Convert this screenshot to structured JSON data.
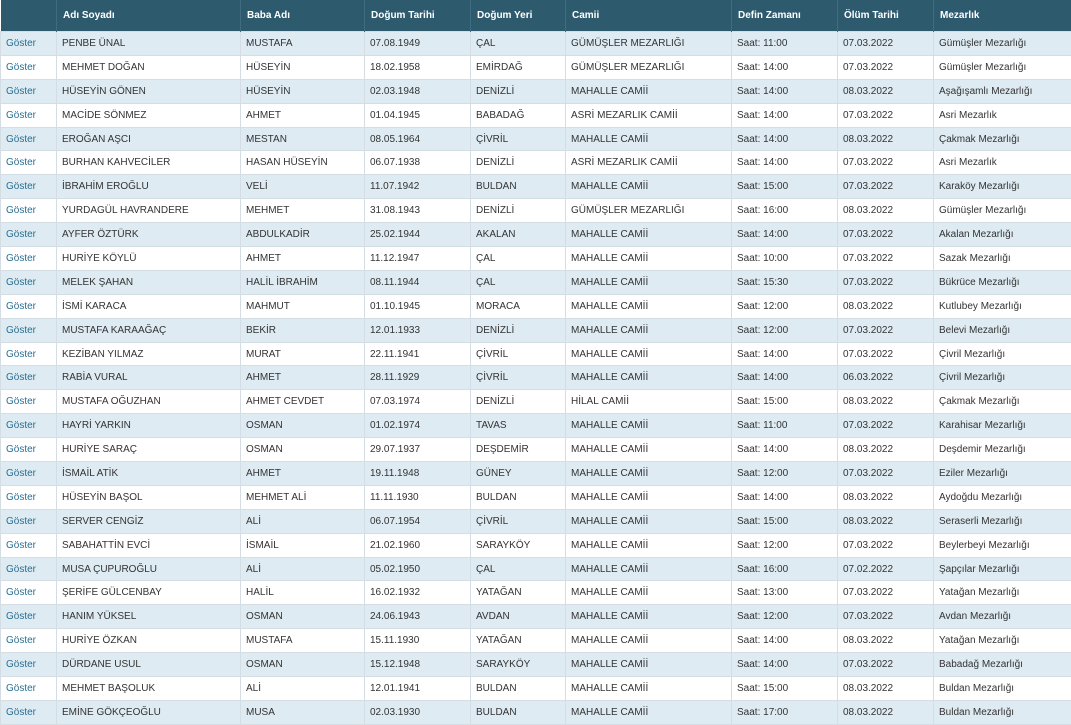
{
  "headers": [
    "",
    "Adı Soyadı",
    "Baba Adı",
    "Doğum Tarihi",
    "Doğum Yeri",
    "Camii",
    "Defin Zamanı",
    "Ölüm Tarihi",
    "Mezarlık"
  ],
  "link_label": "Göster",
  "rows": [
    [
      "PENBE ÜNAL",
      "MUSTAFA",
      "07.08.1949",
      "ÇAL",
      "GÜMÜŞLER MEZARLIĞI",
      "Saat: 11:00",
      "07.03.2022",
      "Gümüşler Mezarlığı"
    ],
    [
      "MEHMET DOĞAN",
      "HÜSEYİN",
      "18.02.1958",
      "EMİRDAĞ",
      "GÜMÜŞLER MEZARLIĞI",
      "Saat: 14:00",
      "07.03.2022",
      "Gümüşler Mezarlığı"
    ],
    [
      "HÜSEYİN GÖNEN",
      "HÜSEYİN",
      "02.03.1948",
      "DENİZLİ",
      "MAHALLE CAMİİ",
      "Saat: 14:00",
      "08.03.2022",
      "Aşağışamlı Mezarlığı"
    ],
    [
      "MACİDE SÖNMEZ",
      "AHMET",
      "01.04.1945",
      "BABADAĞ",
      "ASRİ MEZARLIK CAMİİ",
      "Saat: 14:00",
      "07.03.2022",
      "Asri Mezarlık"
    ],
    [
      "EROĞAN AŞCI",
      "MESTAN",
      "08.05.1964",
      "ÇİVRİL",
      "MAHALLE CAMİİ",
      "Saat: 14:00",
      "08.03.2022",
      "Çakmak Mezarlığı"
    ],
    [
      "BURHAN KAHVECİLER",
      "HASAN HÜSEYİN",
      "06.07.1938",
      "DENİZLİ",
      "ASRİ MEZARLIK CAMİİ",
      "Saat: 14:00",
      "07.03.2022",
      "Asri Mezarlık"
    ],
    [
      "İBRAHİM EROĞLU",
      "VELİ",
      "11.07.1942",
      "BULDAN",
      "MAHALLE CAMİİ",
      "Saat: 15:00",
      "07.03.2022",
      "Karaköy Mezarlığı"
    ],
    [
      "YURDAGÜL HAVRANDERE",
      "MEHMET",
      "31.08.1943",
      "DENİZLİ",
      "GÜMÜŞLER MEZARLIĞI",
      "Saat: 16:00",
      "08.03.2022",
      "Gümüşler Mezarlığı"
    ],
    [
      "AYFER ÖZTÜRK",
      "ABDULKADİR",
      "25.02.1944",
      "AKALAN",
      "MAHALLE CAMİİ",
      "Saat: 14:00",
      "07.03.2022",
      "Akalan Mezarlığı"
    ],
    [
      "HURİYE KÖYLÜ",
      "AHMET",
      "11.12.1947",
      "ÇAL",
      "MAHALLE CAMİİ",
      "Saat: 10:00",
      "07.03.2022",
      "Sazak Mezarlığı"
    ],
    [
      "MELEK ŞAHAN",
      "HALİL İBRAHİM",
      "08.11.1944",
      "ÇAL",
      "MAHALLE CAMİİ",
      "Saat: 15:30",
      "07.03.2022",
      "Bükrüce Mezarlığı"
    ],
    [
      "İSMİ KARACA",
      "MAHMUT",
      "01.10.1945",
      "MORACA",
      "MAHALLE CAMİİ",
      "Saat: 12:00",
      "08.03.2022",
      "Kutlubey Mezarlığı"
    ],
    [
      "MUSTAFA KARAAĞAÇ",
      "BEKİR",
      "12.01.1933",
      "DENİZLİ",
      "MAHALLE CAMİİ",
      "Saat: 12:00",
      "07.03.2022",
      "Belevi Mezarlığı"
    ],
    [
      "KEZİBAN YILMAZ",
      "MURAT",
      "22.11.1941",
      "ÇİVRİL",
      "MAHALLE CAMİİ",
      "Saat: 14:00",
      "07.03.2022",
      "Çivril Mezarlığı"
    ],
    [
      "RABİA VURAL",
      "AHMET",
      "28.11.1929",
      "ÇİVRİL",
      "MAHALLE CAMİİ",
      "Saat: 14:00",
      "06.03.2022",
      "Çivril Mezarlığı"
    ],
    [
      "MUSTAFA OĞUZHAN",
      "AHMET CEVDET",
      "07.03.1974",
      "DENİZLİ",
      "HİLAL CAMİİ",
      "Saat: 15:00",
      "08.03.2022",
      "Çakmak Mezarlığı"
    ],
    [
      "HAYRİ YARKIN",
      "OSMAN",
      "01.02.1974",
      "TAVAS",
      "MAHALLE CAMİİ",
      "Saat: 11:00",
      "07.03.2022",
      "Karahisar Mezarlığı"
    ],
    [
      "HURİYE SARAÇ",
      "OSMAN",
      "29.07.1937",
      "DEŞDEMİR",
      "MAHALLE CAMİİ",
      "Saat: 14:00",
      "08.03.2022",
      "Deşdemir Mezarlığı"
    ],
    [
      "İSMAİL ATİK",
      "AHMET",
      "19.11.1948",
      "GÜNEY",
      "MAHALLE CAMİİ",
      "Saat: 12:00",
      "07.03.2022",
      "Eziler Mezarlığı"
    ],
    [
      "HÜSEYİN BAŞOL",
      "MEHMET ALİ",
      "11.11.1930",
      "BULDAN",
      "MAHALLE CAMİİ",
      "Saat: 14:00",
      "08.03.2022",
      "Aydoğdu Mezarlığı"
    ],
    [
      "SERVER CENGİZ",
      "ALİ",
      "06.07.1954",
      "ÇİVRİL",
      "MAHALLE CAMİİ",
      "Saat: 15:00",
      "08.03.2022",
      "Seraserli Mezarlığı"
    ],
    [
      "SABAHATTİN EVCİ",
      "İSMAİL",
      "21.02.1960",
      "SARAYKÖY",
      "MAHALLE CAMİİ",
      "Saat: 12:00",
      "07.03.2022",
      "Beylerbeyi Mezarlığı"
    ],
    [
      "MUSA ÇUPUROĞLU",
      "ALİ",
      "05.02.1950",
      "ÇAL",
      "MAHALLE CAMİİ",
      "Saat: 16:00",
      "07.02.2022",
      "Şapçılar Mezarlığı"
    ],
    [
      "ŞERİFE GÜLCENBAY",
      "HALİL",
      "16.02.1932",
      "YATAĞAN",
      "MAHALLE CAMİİ",
      "Saat: 13:00",
      "07.03.2022",
      "Yatağan Mezarlığı"
    ],
    [
      "HANIM YÜKSEL",
      "OSMAN",
      "24.06.1943",
      "AVDAN",
      "MAHALLE CAMİİ",
      "Saat: 12:00",
      "07.03.2022",
      "Avdan Mezarlığı"
    ],
    [
      "HURİYE ÖZKAN",
      "MUSTAFA",
      "15.11.1930",
      "YATAĞAN",
      "MAHALLE CAMİİ",
      "Saat: 14:00",
      "08.03.2022",
      "Yatağan Mezarlığı"
    ],
    [
      "DÜRDANE USUL",
      "OSMAN",
      "15.12.1948",
      "SARAYKÖY",
      "MAHALLE CAMİİ",
      "Saat: 14:00",
      "07.03.2022",
      "Babadağ Mezarlığı"
    ],
    [
      "MEHMET BAŞOLUK",
      "ALİ",
      "12.01.1941",
      "BULDAN",
      "MAHALLE CAMİİ",
      "Saat: 15:00",
      "08.03.2022",
      "Buldan Mezarlığı"
    ],
    [
      "EMİNE GÖKÇEOĞLU",
      "MUSA",
      "02.03.1930",
      "BULDAN",
      "MAHALLE CAMİİ",
      "Saat: 17:00",
      "08.03.2022",
      "Buldan Mezarlığı"
    ]
  ],
  "colors": {
    "header_bg": "#2e5a6e",
    "row_alt_bg": "#deebf2",
    "link": "#2a6f93"
  }
}
